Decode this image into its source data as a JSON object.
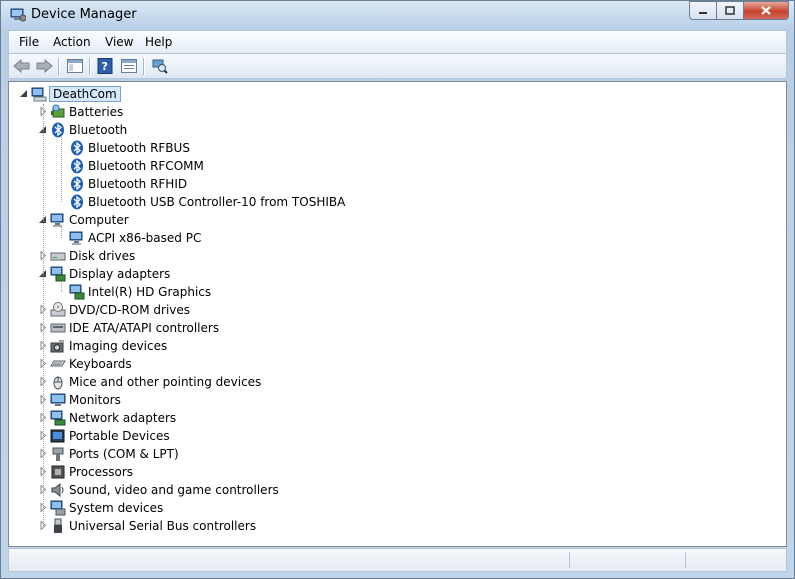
{
  "window": {
    "title": "Device Manager"
  },
  "menu": [
    "File",
    "Action",
    "View",
    "Help"
  ],
  "toolbar": {
    "buttons": [
      "back-icon",
      "forward-icon",
      "show-hide-console-tree-icon",
      "help-icon",
      "properties-icon",
      "scan-hardware-icon"
    ]
  },
  "tree": {
    "root": "DeathCom",
    "items": [
      {
        "label": "Batteries",
        "icon": "battery-icon",
        "expanded": false,
        "level": 1
      },
      {
        "label": "Bluetooth",
        "icon": "bluetooth-icon",
        "expanded": true,
        "level": 1
      },
      {
        "label": "Bluetooth RFBUS",
        "icon": "bluetooth-icon",
        "level": 2
      },
      {
        "label": "Bluetooth RFCOMM",
        "icon": "bluetooth-icon",
        "level": 2
      },
      {
        "label": "Bluetooth RFHID",
        "icon": "bluetooth-icon",
        "level": 2
      },
      {
        "label": "Bluetooth USB Controller-10 from TOSHIBA",
        "icon": "bluetooth-icon",
        "level": 2
      },
      {
        "label": "Computer",
        "icon": "computer-icon",
        "expanded": true,
        "level": 1
      },
      {
        "label": "ACPI x86-based PC",
        "icon": "computer-icon",
        "level": 2
      },
      {
        "label": "Disk drives",
        "icon": "disk-drive-icon",
        "expanded": false,
        "level": 1
      },
      {
        "label": "Display adapters",
        "icon": "display-adapter-icon",
        "expanded": true,
        "level": 1
      },
      {
        "label": "Intel(R) HD Graphics",
        "icon": "display-adapter-icon",
        "level": 2
      },
      {
        "label": "DVD/CD-ROM drives",
        "icon": "dvd-drive-icon",
        "expanded": false,
        "level": 1
      },
      {
        "label": "IDE ATA/ATAPI controllers",
        "icon": "ide-controller-icon",
        "expanded": false,
        "level": 1
      },
      {
        "label": "Imaging devices",
        "icon": "camera-icon",
        "expanded": false,
        "level": 1
      },
      {
        "label": "Keyboards",
        "icon": "keyboard-icon",
        "expanded": false,
        "level": 1
      },
      {
        "label": "Mice and other pointing devices",
        "icon": "mouse-icon",
        "expanded": false,
        "level": 1
      },
      {
        "label": "Monitors",
        "icon": "monitor-icon",
        "expanded": false,
        "level": 1
      },
      {
        "label": "Network adapters",
        "icon": "network-adapter-icon",
        "expanded": false,
        "level": 1
      },
      {
        "label": "Portable Devices",
        "icon": "portable-device-icon",
        "expanded": false,
        "level": 1
      },
      {
        "label": "Ports (COM & LPT)",
        "icon": "port-icon",
        "expanded": false,
        "level": 1
      },
      {
        "label": "Processors",
        "icon": "processor-icon",
        "expanded": false,
        "level": 1
      },
      {
        "label": "Sound, video and game controllers",
        "icon": "speaker-icon",
        "expanded": false,
        "level": 1
      },
      {
        "label": "System devices",
        "icon": "system-device-icon",
        "expanded": false,
        "level": 1
      },
      {
        "label": "Universal Serial Bus controllers",
        "icon": "usb-icon",
        "expanded": false,
        "level": 1
      }
    ]
  },
  "colors": {
    "selection": "#d6e8fc",
    "bluetooth": "#1565c0",
    "close_button": "#c7442c"
  }
}
